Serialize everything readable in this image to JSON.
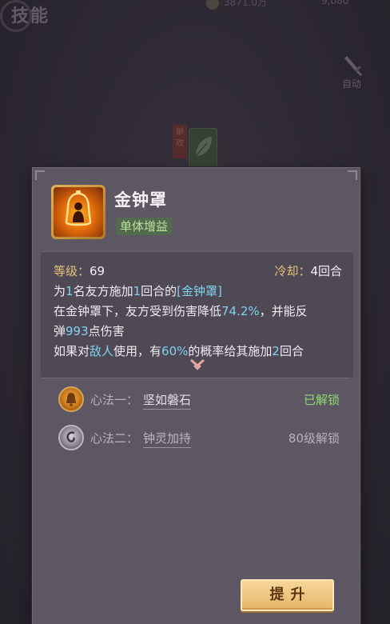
{
  "topbar": {
    "title": "技能",
    "currency_1": "3871.0万",
    "currency_2": "9,080"
  },
  "auto_button": {
    "label": "自动"
  },
  "mini_skill": {
    "tag": "单攻"
  },
  "skill": {
    "name": "金钟罩",
    "type": "单体增益",
    "level_label": "等级：",
    "level_value": "69",
    "cooldown_label": "冷却：",
    "cooldown_value": "4回合",
    "desc_line1_a": "为",
    "desc_line1_b": "1",
    "desc_line1_c": "名友方施加",
    "desc_line1_d": "1",
    "desc_line1_e": "回合的",
    "desc_line1_f": "[金钟罩]",
    "desc_line2_a": "在金钟罩下，友方受到伤害降低",
    "desc_line2_b": "74.2%",
    "desc_line2_c": "，并能反",
    "desc_line3_a": "弹",
    "desc_line3_b": "993",
    "desc_line3_c": "点伤害",
    "desc_line4_a": "如果对",
    "desc_line4_b": "敌人",
    "desc_line4_c": "使用，有",
    "desc_line4_d": "60%",
    "desc_line4_e": "的概率给其施加",
    "desc_line4_f": "2",
    "desc_line4_g": "回合"
  },
  "methods": [
    {
      "label": "心法一：",
      "name": "坚如磐石",
      "status": "已解锁",
      "icon": "bell-icon"
    },
    {
      "label": "心法二：",
      "name": "钟灵加持",
      "status": "80级解锁",
      "icon": "spiral-icon"
    }
  ],
  "upgrade_button": {
    "label": "提升"
  },
  "colors": {
    "highlight": "#7fd3f0",
    "gold_label": "#e8c27a",
    "unlocked": "#8fd870",
    "panel": "#5c5762"
  }
}
